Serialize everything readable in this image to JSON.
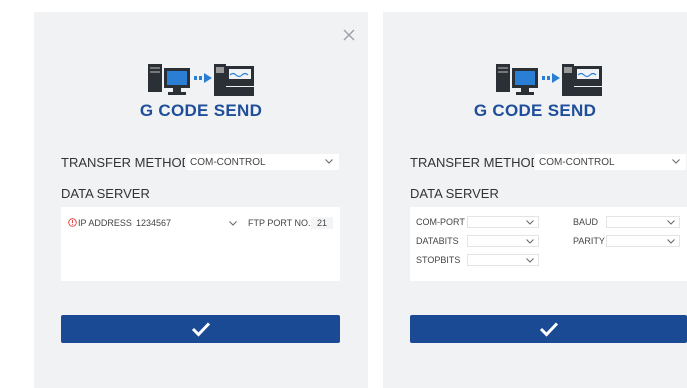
{
  "colors": {
    "accent": "#1b4a94",
    "title": "#1f4e9a",
    "panel_bg": "#f1f2f4",
    "warning": "#e53935"
  },
  "panel_ip": {
    "app_title": "G CODE SEND",
    "transfer_method_label": "TRANSFER METHOD",
    "transfer_method_value": "COM-CONTROL",
    "data_server_label": "DATA SERVER",
    "ip_label": "IP ADDRESS",
    "ip_value": "1234567",
    "ftp_port_label": "FTP PORT NO.",
    "ftp_port_value": "21",
    "close_icon": "close-icon",
    "confirm_icon": "checkmark-icon"
  },
  "panel_com": {
    "app_title": "G CODE SEND",
    "transfer_method_label": "TRANSFER METHOD",
    "transfer_method_value": "COM-CONTROL",
    "data_server_label": "DATA SERVER",
    "com_port_label": "COM-PORT",
    "baud_label": "BAUD",
    "databits_label": "DATABITS",
    "parity_label": "PARITY",
    "stopbits_label": "STOPBITS",
    "confirm_icon": "checkmark-icon"
  }
}
